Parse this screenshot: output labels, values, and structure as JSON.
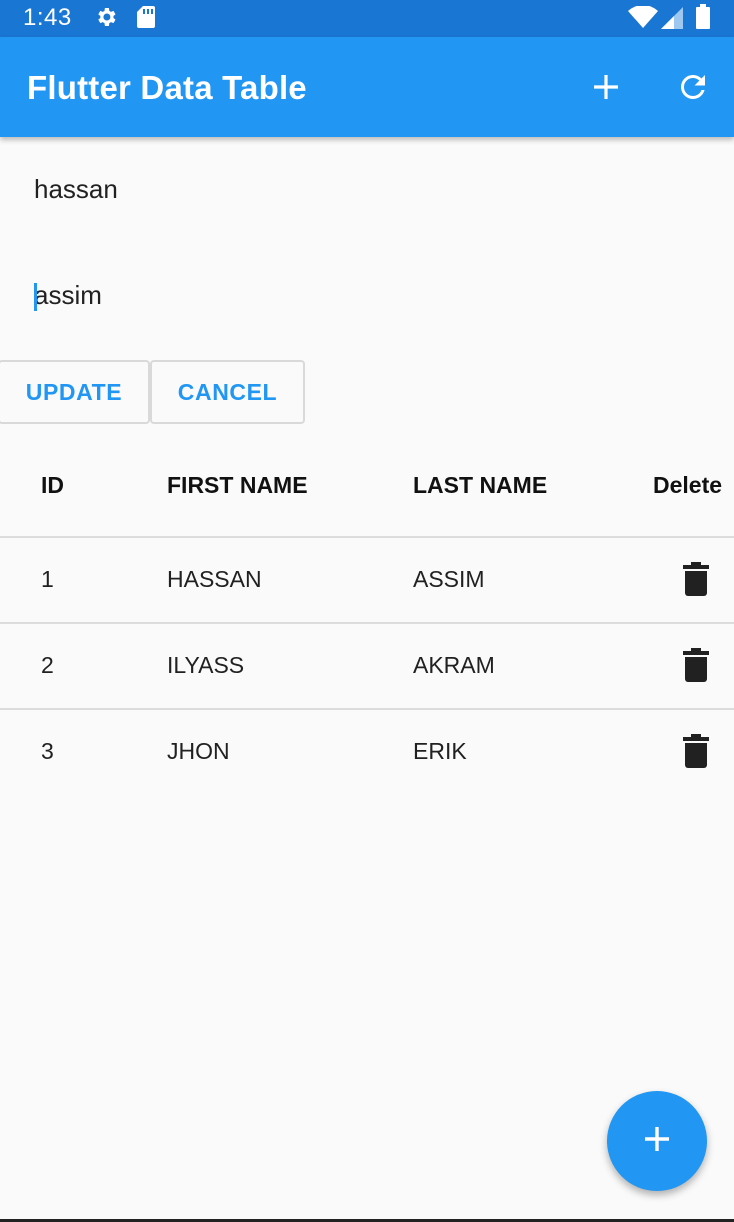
{
  "status_bar": {
    "time": "1:43",
    "icons": [
      "gear-icon",
      "sd-card-icon",
      "wifi-icon",
      "signal-icon",
      "battery-icon"
    ]
  },
  "app_bar": {
    "title": "Flutter Data Table",
    "actions": [
      "add-icon",
      "refresh-icon"
    ]
  },
  "form": {
    "first_name_value": "hassan",
    "last_name_value": "assim",
    "update_label": "UPDATE",
    "cancel_label": "CANCEL"
  },
  "table": {
    "columns": [
      "ID",
      "FIRST NAME",
      "LAST NAME",
      "Delete"
    ],
    "rows": [
      {
        "id": "1",
        "first_name": "HASSAN",
        "last_name": "ASSIM"
      },
      {
        "id": "2",
        "first_name": "ILYASS",
        "last_name": "AKRAM"
      },
      {
        "id": "3",
        "first_name": "JHON",
        "last_name": "ERIK"
      }
    ]
  },
  "fab": {
    "icon": "add-icon"
  },
  "colors": {
    "primary": "#2196f3",
    "status_bar": "#1976d2",
    "background": "#fafafa"
  }
}
